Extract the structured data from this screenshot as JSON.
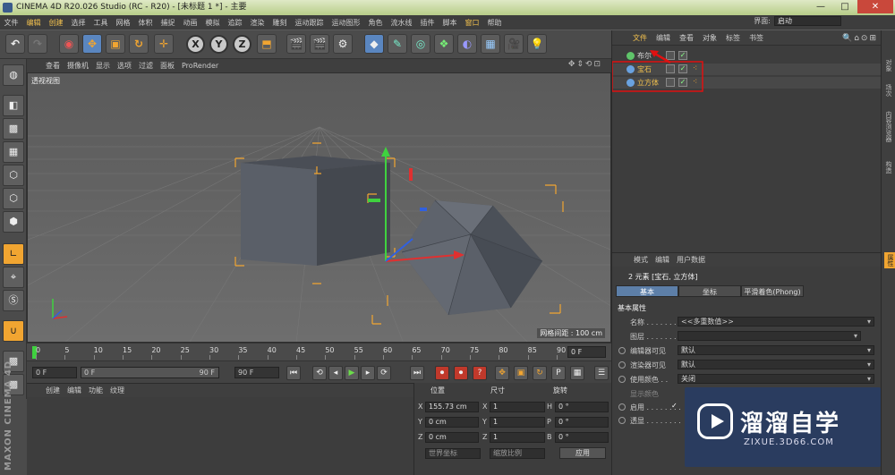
{
  "window": {
    "title": "CINEMA 4D R20.026 Studio (RC - R20) - [未标题 1 *] - 主要",
    "minimize": "—",
    "maximize": "□",
    "close": "✕"
  },
  "menu": [
    "文件",
    "编辑",
    "创建",
    "选择",
    "工具",
    "网格",
    "体积",
    "捕捉",
    "动画",
    "模拟",
    "追踪",
    "渲染",
    "雕刻",
    "运动跟踪",
    "运动图形",
    "角色",
    "流水线",
    "插件",
    "脚本",
    "窗口",
    "帮助"
  ],
  "layout": {
    "label": "界面:",
    "value": "启动"
  },
  "toolbar": {
    "undo": "↶",
    "redo": "↷",
    "x": "X",
    "y": "Y",
    "z": "Z"
  },
  "viewport": {
    "menu": [
      "查看",
      "摄像机",
      "显示",
      "选项",
      "过滤",
      "面板",
      "ProRender"
    ],
    "label": "透视视图",
    "grid_note": "网格间距 : 100 cm",
    "nav_icons": "✥⇕⟲⊡"
  },
  "timeline": {
    "ticks": [
      "0",
      "5",
      "10",
      "15",
      "20",
      "25",
      "30",
      "35",
      "40",
      "45",
      "50",
      "55",
      "60",
      "65",
      "70",
      "75",
      "80",
      "85",
      "90"
    ],
    "frame": "0 F"
  },
  "playback": {
    "start": "0 F",
    "range_start": "0 F",
    "range_end": "90 F",
    "end": "90 F"
  },
  "material_menu": [
    "创建",
    "编辑",
    "功能",
    "纹理"
  ],
  "coords": {
    "headers": [
      "位置",
      "尺寸",
      "旋转"
    ],
    "rows": [
      {
        "axis": "X",
        "pos": "155.73 cm",
        "saxis": "X",
        "size": "1",
        "raxis": "H",
        "rot": "0 °"
      },
      {
        "axis": "Y",
        "pos": "0 cm",
        "saxis": "Y",
        "size": "1",
        "raxis": "P",
        "rot": "0 °"
      },
      {
        "axis": "Z",
        "pos": "0 cm",
        "saxis": "Z",
        "size": "1",
        "raxis": "B",
        "rot": "0 °"
      }
    ],
    "mode1": "世界坐标",
    "mode2": "缩放比例",
    "apply": "应用"
  },
  "objects": {
    "menu": [
      "文件",
      "编辑",
      "查看",
      "对象",
      "标签",
      "书签"
    ],
    "icons": "🔍⌂⊙⊞",
    "items": [
      {
        "name": "布尔",
        "color": "#d8d8d8",
        "icon": "#5fc46a"
      },
      {
        "name": "宝石",
        "color": "#f2c14e",
        "icon": "#6aa2e0"
      },
      {
        "name": "立方体",
        "color": "#f2c14e",
        "icon": "#6aa2e0"
      }
    ]
  },
  "attributes": {
    "menu": [
      "模式",
      "编辑",
      "用户数据"
    ],
    "summary": "2 元素 [宝石, 立方体]",
    "tabs": [
      "基本",
      "坐标",
      "平滑着色(Phong)"
    ],
    "section": "基本属性",
    "name_label": "名称 . . . . . . . .",
    "name_value": "<<多重数值>>",
    "layer_label": "图层 . . . . . . . .",
    "rows": [
      {
        "label": "编辑器可见",
        "value": "默认"
      },
      {
        "label": "渲染器可见",
        "value": "默认"
      },
      {
        "label": "使用颜色 . .",
        "value": "关闭"
      }
    ],
    "display_color": "显示颜色",
    "enable_label": "启用 . . . . . . . .",
    "xray_label": "透显 . . . . . . . .",
    "check": "✓"
  },
  "right_tabs": [
    "对象",
    "场次",
    "内容浏览器",
    "构造",
    "属性"
  ],
  "watermark": {
    "title": "溜溜自学",
    "url": "ZIXUE.3D66.COM"
  },
  "maxon": "MAXON CINEMA 4D"
}
